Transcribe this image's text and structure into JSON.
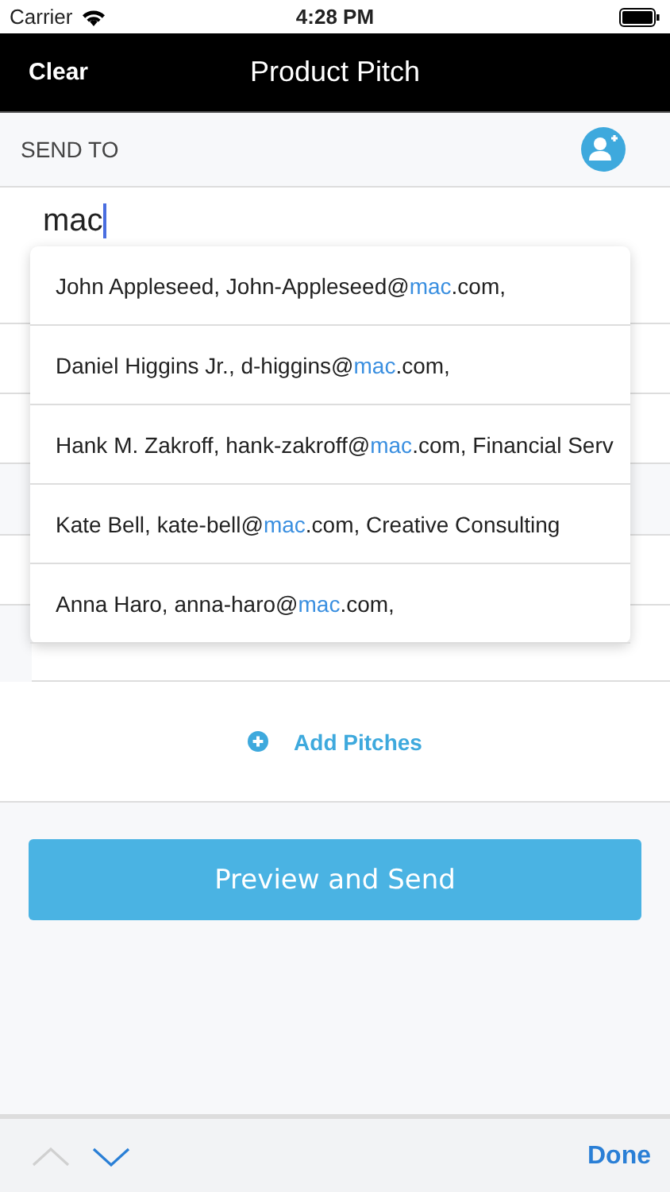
{
  "status_bar": {
    "carrier": "Carrier",
    "time": "4:28 PM"
  },
  "nav": {
    "left_button": "Clear",
    "title": "Product Pitch"
  },
  "send_to": {
    "label": "SEND TO",
    "value": "mac"
  },
  "suggestions": [
    {
      "before": "John Appleseed, John-Appleseed@",
      "match": "mac",
      "after": ".com,"
    },
    {
      "before": "Daniel Higgins Jr., d-higgins@",
      "match": "mac",
      "after": ".com,"
    },
    {
      "before": "Hank M. Zakroff, hank-zakroff@",
      "match": "mac",
      "after": ".com, Financial Serv"
    },
    {
      "before": "Kate Bell, kate-bell@",
      "match": "mac",
      "after": ".com, Creative Consulting"
    },
    {
      "before": "Anna Haro, anna-haro@",
      "match": "mac",
      "after": ".com,"
    }
  ],
  "pitches_section": {
    "add_button": "Add Pitches"
  },
  "preview_button": "Preview and Send",
  "toolbar": {
    "prev_disabled": true,
    "next_disabled": false,
    "done": "Done"
  }
}
